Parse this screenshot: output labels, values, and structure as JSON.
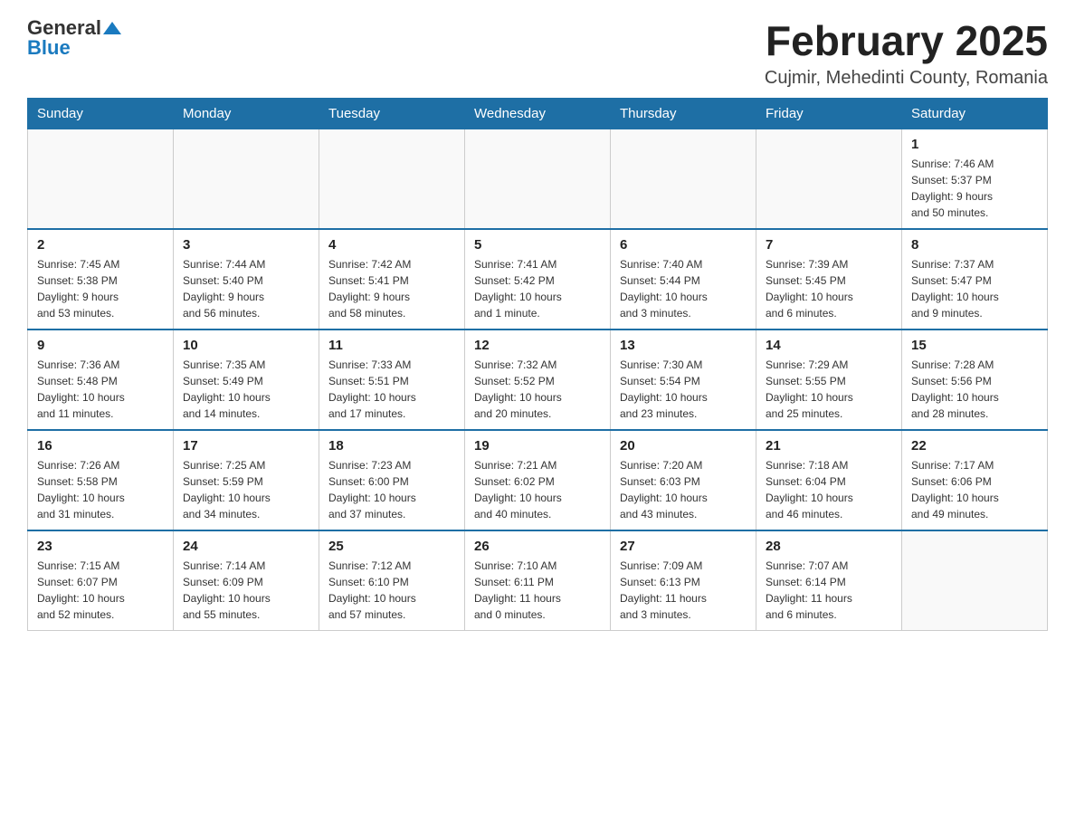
{
  "header": {
    "logo_general": "General",
    "logo_blue": "Blue",
    "main_title": "February 2025",
    "subtitle": "Cujmir, Mehedinti County, Romania"
  },
  "weekdays": [
    "Sunday",
    "Monday",
    "Tuesday",
    "Wednesday",
    "Thursday",
    "Friday",
    "Saturday"
  ],
  "weeks": [
    [
      {
        "day": "",
        "info": ""
      },
      {
        "day": "",
        "info": ""
      },
      {
        "day": "",
        "info": ""
      },
      {
        "day": "",
        "info": ""
      },
      {
        "day": "",
        "info": ""
      },
      {
        "day": "",
        "info": ""
      },
      {
        "day": "1",
        "info": "Sunrise: 7:46 AM\nSunset: 5:37 PM\nDaylight: 9 hours\nand 50 minutes."
      }
    ],
    [
      {
        "day": "2",
        "info": "Sunrise: 7:45 AM\nSunset: 5:38 PM\nDaylight: 9 hours\nand 53 minutes."
      },
      {
        "day": "3",
        "info": "Sunrise: 7:44 AM\nSunset: 5:40 PM\nDaylight: 9 hours\nand 56 minutes."
      },
      {
        "day": "4",
        "info": "Sunrise: 7:42 AM\nSunset: 5:41 PM\nDaylight: 9 hours\nand 58 minutes."
      },
      {
        "day": "5",
        "info": "Sunrise: 7:41 AM\nSunset: 5:42 PM\nDaylight: 10 hours\nand 1 minute."
      },
      {
        "day": "6",
        "info": "Sunrise: 7:40 AM\nSunset: 5:44 PM\nDaylight: 10 hours\nand 3 minutes."
      },
      {
        "day": "7",
        "info": "Sunrise: 7:39 AM\nSunset: 5:45 PM\nDaylight: 10 hours\nand 6 minutes."
      },
      {
        "day": "8",
        "info": "Sunrise: 7:37 AM\nSunset: 5:47 PM\nDaylight: 10 hours\nand 9 minutes."
      }
    ],
    [
      {
        "day": "9",
        "info": "Sunrise: 7:36 AM\nSunset: 5:48 PM\nDaylight: 10 hours\nand 11 minutes."
      },
      {
        "day": "10",
        "info": "Sunrise: 7:35 AM\nSunset: 5:49 PM\nDaylight: 10 hours\nand 14 minutes."
      },
      {
        "day": "11",
        "info": "Sunrise: 7:33 AM\nSunset: 5:51 PM\nDaylight: 10 hours\nand 17 minutes."
      },
      {
        "day": "12",
        "info": "Sunrise: 7:32 AM\nSunset: 5:52 PM\nDaylight: 10 hours\nand 20 minutes."
      },
      {
        "day": "13",
        "info": "Sunrise: 7:30 AM\nSunset: 5:54 PM\nDaylight: 10 hours\nand 23 minutes."
      },
      {
        "day": "14",
        "info": "Sunrise: 7:29 AM\nSunset: 5:55 PM\nDaylight: 10 hours\nand 25 minutes."
      },
      {
        "day": "15",
        "info": "Sunrise: 7:28 AM\nSunset: 5:56 PM\nDaylight: 10 hours\nand 28 minutes."
      }
    ],
    [
      {
        "day": "16",
        "info": "Sunrise: 7:26 AM\nSunset: 5:58 PM\nDaylight: 10 hours\nand 31 minutes."
      },
      {
        "day": "17",
        "info": "Sunrise: 7:25 AM\nSunset: 5:59 PM\nDaylight: 10 hours\nand 34 minutes."
      },
      {
        "day": "18",
        "info": "Sunrise: 7:23 AM\nSunset: 6:00 PM\nDaylight: 10 hours\nand 37 minutes."
      },
      {
        "day": "19",
        "info": "Sunrise: 7:21 AM\nSunset: 6:02 PM\nDaylight: 10 hours\nand 40 minutes."
      },
      {
        "day": "20",
        "info": "Sunrise: 7:20 AM\nSunset: 6:03 PM\nDaylight: 10 hours\nand 43 minutes."
      },
      {
        "day": "21",
        "info": "Sunrise: 7:18 AM\nSunset: 6:04 PM\nDaylight: 10 hours\nand 46 minutes."
      },
      {
        "day": "22",
        "info": "Sunrise: 7:17 AM\nSunset: 6:06 PM\nDaylight: 10 hours\nand 49 minutes."
      }
    ],
    [
      {
        "day": "23",
        "info": "Sunrise: 7:15 AM\nSunset: 6:07 PM\nDaylight: 10 hours\nand 52 minutes."
      },
      {
        "day": "24",
        "info": "Sunrise: 7:14 AM\nSunset: 6:09 PM\nDaylight: 10 hours\nand 55 minutes."
      },
      {
        "day": "25",
        "info": "Sunrise: 7:12 AM\nSunset: 6:10 PM\nDaylight: 10 hours\nand 57 minutes."
      },
      {
        "day": "26",
        "info": "Sunrise: 7:10 AM\nSunset: 6:11 PM\nDaylight: 11 hours\nand 0 minutes."
      },
      {
        "day": "27",
        "info": "Sunrise: 7:09 AM\nSunset: 6:13 PM\nDaylight: 11 hours\nand 3 minutes."
      },
      {
        "day": "28",
        "info": "Sunrise: 7:07 AM\nSunset: 6:14 PM\nDaylight: 11 hours\nand 6 minutes."
      },
      {
        "day": "",
        "info": ""
      }
    ]
  ]
}
